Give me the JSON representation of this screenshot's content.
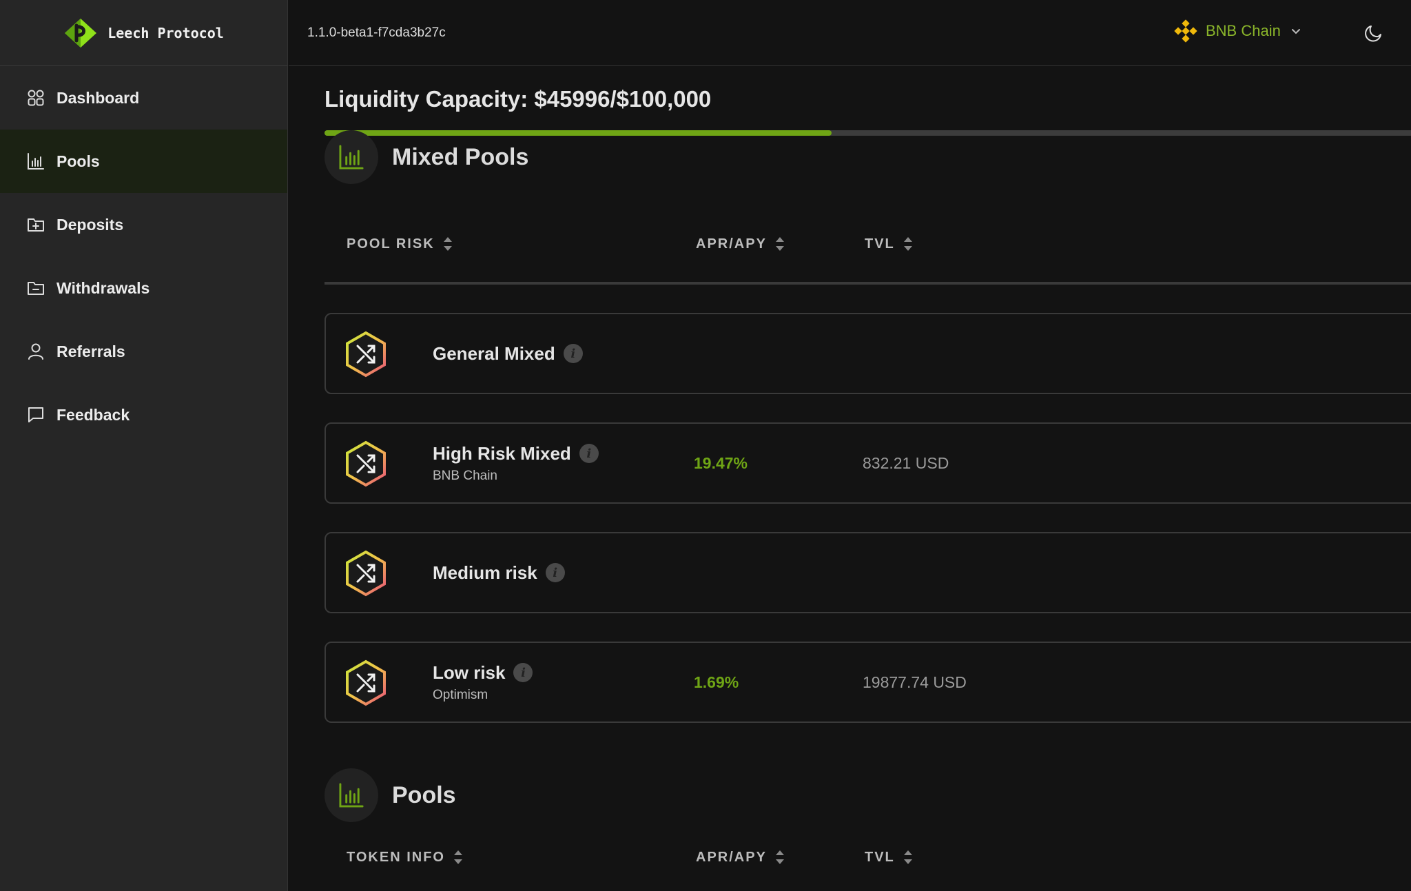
{
  "brand": {
    "name": "Leech Protocol",
    "accent": "#8fe11a"
  },
  "topbar": {
    "version": "1.1.0-beta1-f7cda3b27c",
    "chain": "BNB Chain",
    "chain_color": "#f0b90b"
  },
  "sidebar": {
    "items": [
      {
        "label": "Dashboard",
        "icon": "grid-icon",
        "active": false
      },
      {
        "label": "Pools",
        "icon": "bar-chart-icon",
        "active": true
      },
      {
        "label": "Deposits",
        "icon": "folder-plus-icon",
        "active": false
      },
      {
        "label": "Withdrawals",
        "icon": "folder-minus-icon",
        "active": false
      },
      {
        "label": "Referrals",
        "icon": "user-icon",
        "active": false
      },
      {
        "label": "Feedback",
        "icon": "message-icon",
        "active": false
      }
    ]
  },
  "capacity": {
    "title": "Liquidity Capacity: $45996/$100,000",
    "progress": 0.46
  },
  "mixed_pools": {
    "title": "Mixed Pools",
    "columns": [
      "POOL RISK",
      "APR/APY",
      "TVL"
    ],
    "rows": [
      {
        "name": "General Mixed",
        "chain": "",
        "apr": "",
        "tvl": ""
      },
      {
        "name": "High Risk Mixed",
        "chain": "BNB Chain",
        "apr": "19.47%",
        "tvl": "832.21 USD"
      },
      {
        "name": "Medium risk",
        "chain": "",
        "apr": "",
        "tvl": ""
      },
      {
        "name": "Low risk",
        "chain": "Optimism",
        "apr": "1.69%",
        "tvl": "19877.74 USD"
      }
    ]
  },
  "pools": {
    "title": "Pools",
    "columns": [
      "TOKEN INFO",
      "APR/APY",
      "TVL"
    ]
  }
}
